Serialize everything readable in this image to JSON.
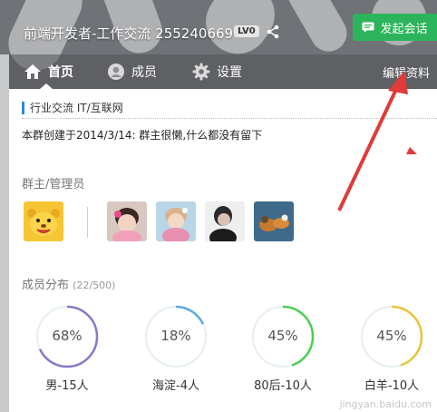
{
  "header": {
    "group_title": "前端开发者-工作交流 255240669",
    "level_badge": "LV0",
    "start_chat_label": "发起会话"
  },
  "nav": {
    "items": [
      {
        "label": "首页",
        "icon": "home-icon",
        "active": true
      },
      {
        "label": "成员",
        "icon": "user-icon",
        "active": false
      },
      {
        "label": "设置",
        "icon": "gear-icon",
        "active": false
      }
    ],
    "edit_label": "编辑资料"
  },
  "group": {
    "category": "行业交流  IT/互联网",
    "intro": "本群创建于2014/3/14:  群主很懒,什么都没有留下"
  },
  "admins": {
    "title": "群主/管理员"
  },
  "distribution": {
    "title": "成员分布",
    "count": "(22/500)",
    "items": [
      {
        "percent": "68%",
        "value": 0.68,
        "label": "男-15人",
        "color": "#8a78c8"
      },
      {
        "percent": "18%",
        "value": 0.18,
        "label": "海淀-4人",
        "color": "#5aa9e0"
      },
      {
        "percent": "45%",
        "value": 0.45,
        "label": "80后-10人",
        "color": "#4ccf52"
      },
      {
        "percent": "45%",
        "value": 0.45,
        "label": "白羊-10人",
        "color": "#e8c43a"
      }
    ]
  },
  "annotation_color": "#e03a3a",
  "watermark": "jingyan.baidu.com"
}
